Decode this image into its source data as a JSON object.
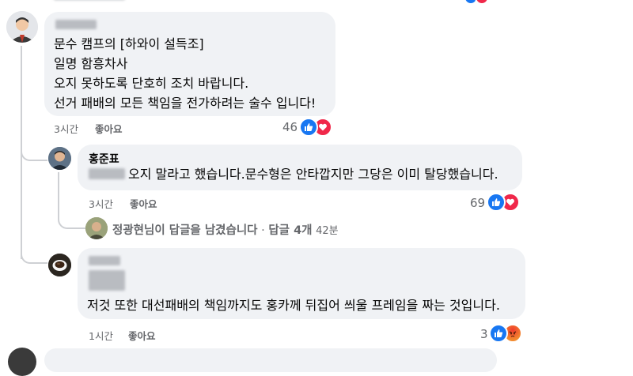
{
  "comments": [
    {
      "time": "3시간",
      "like_label": "좋아요",
      "lines": [
        "문수 캠프의 [하와이 설득조]",
        "일명 함흥차사",
        "오지 못하도록 단호히 조치 바랍니다.",
        "선거 패배의 모든 책임을 전가하려는 술수 입니다!"
      ],
      "reaction_count": "46",
      "reactions": [
        "like-icon",
        "love-icon"
      ]
    },
    {
      "author": "홍준표",
      "text": "오지 말라고 했습니다.문수형은 안타깝지만 그당은 이미 탈당했습니다.",
      "time": "3시간",
      "like_label": "좋아요",
      "reaction_count": "69",
      "reactions": [
        "like-icon",
        "love-icon"
      ],
      "reply_summary": {
        "text": "정광현님이 답글을 남겼습니다",
        "separator": "·",
        "replies": "답글 4개",
        "time": "42분"
      }
    },
    {
      "text": "저것 또한 대선패배의 책임까지도 홍카께 뒤집어 씌울 프레임을 짜는 것입니다.",
      "time": "1시간",
      "like_label": "좋아요",
      "reaction_count": "3",
      "reactions": [
        "like-icon",
        "angry-icon"
      ]
    }
  ],
  "colors": {
    "bubble": "#f0f2f5",
    "meta_text": "#65676b",
    "like": "#1877f2",
    "love": "#f0284a",
    "angry": "#f28a2e",
    "thread_line": "#ced0d4"
  }
}
